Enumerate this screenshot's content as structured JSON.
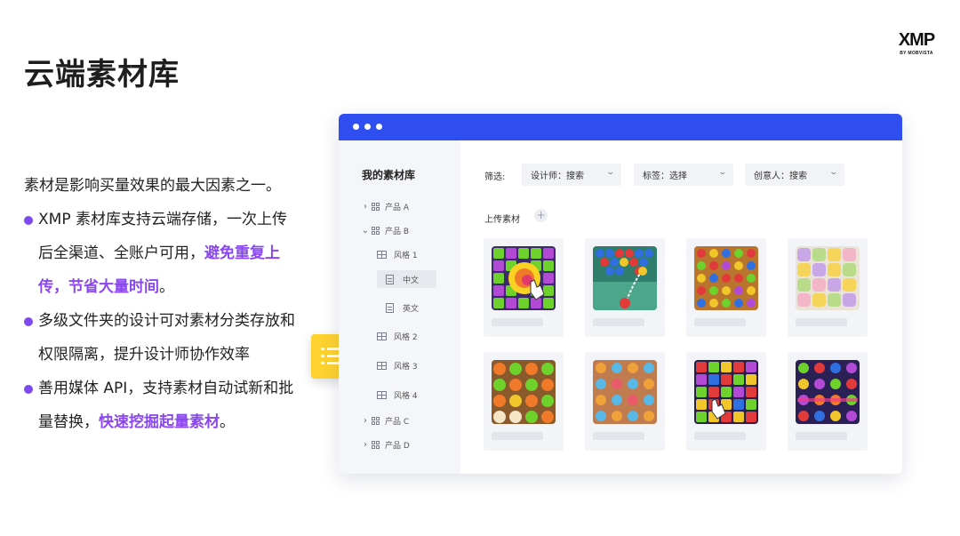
{
  "slide": {
    "title": "云端素材库",
    "logo": {
      "main": "XMP",
      "sub": "BY MOBVISTA"
    }
  },
  "text": {
    "intro": "素材是影响买量效果的最大因素之一。",
    "bullets": [
      {
        "text": "XMP 素材库支持云端存储，一次上传后全渠道、全账户可用，",
        "highlight": "避免重复上传，节省大量时间",
        "tail": "。"
      },
      {
        "text": "多级文件夹的设计可对素材分类存放和权限隔离，提升设计师协作效率",
        "highlight": "",
        "tail": ""
      },
      {
        "text": "善用媒体 API，支持素材自动试新和批量替换，",
        "highlight": "快速挖掘起量素材",
        "tail": "。"
      }
    ],
    "bullet_color": "#7d4af0",
    "highlight_color": "#8a47f0"
  },
  "float_icon": {
    "icon": "list-icon",
    "color": "#fed22f"
  },
  "window": {
    "titlebar_color": "#2f4ef0",
    "sidebar": {
      "title": "我的素材库",
      "items": [
        {
          "label": "产品 A",
          "level": 0,
          "chevron": "›",
          "icon": "folder-grid-icon"
        },
        {
          "label": "产品 B",
          "level": 0,
          "chevron": "⌄",
          "icon": "folder-grid-icon"
        },
        {
          "label": "风格 1",
          "level": 1,
          "icon": "table-icon"
        },
        {
          "label": "中文",
          "level": 2,
          "icon": "document-icon",
          "selected": true
        },
        {
          "label": "英文",
          "level": 2,
          "icon": "document-icon"
        },
        {
          "label": "风格 2",
          "level": 1,
          "icon": "table-icon"
        },
        {
          "label": "风格 3",
          "level": 1,
          "icon": "table-icon"
        },
        {
          "label": "风格 4",
          "level": 1,
          "icon": "table-icon"
        },
        {
          "label": "产品 C",
          "level": 0,
          "chevron": "›",
          "icon": "folder-grid-icon"
        },
        {
          "label": "产品 D",
          "level": 0,
          "chevron": "›",
          "icon": "folder-grid-icon"
        }
      ]
    },
    "filters": {
      "label": "筛选:",
      "designer": "设计师：搜索",
      "tags": "标签：选择",
      "creator": "创意人：搜索"
    },
    "upload": {
      "label": "上传素材",
      "icon": "plus-icon"
    },
    "assets": [
      {
        "name": "candy-tap-thumbnail"
      },
      {
        "name": "bubble-shooter-thumbnail"
      },
      {
        "name": "gem-match-thumbnail"
      },
      {
        "name": "pastel-animals-thumbnail"
      },
      {
        "name": "fruit-faces-thumbnail"
      },
      {
        "name": "flower-match-thumbnail"
      },
      {
        "name": "jelly-blocks-thumbnail"
      },
      {
        "name": "monster-match-thumbnail"
      }
    ]
  }
}
